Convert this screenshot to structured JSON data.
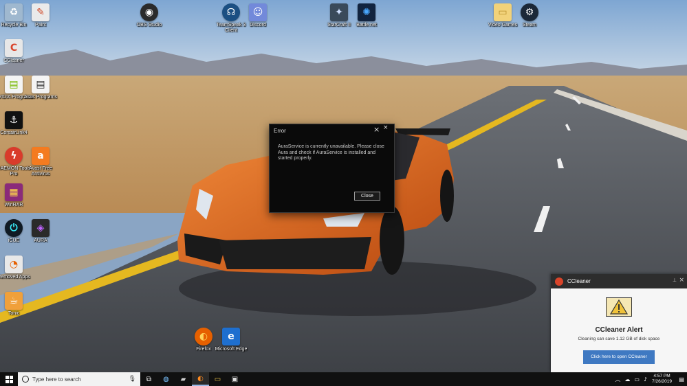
{
  "desktop": {
    "icons": [
      {
        "label": "Recycle Bin",
        "icon": "recycle-bin-icon",
        "color": "#9fb8cf"
      },
      {
        "label": "Paint",
        "icon": "paint-icon",
        "color": "#e8e8e8"
      },
      {
        "label": "OBS Studio",
        "icon": "obs-icon",
        "color": "#2b2b2b"
      },
      {
        "label": "TeamSpeak 3 Client",
        "icon": "teamspeak-icon",
        "color": "#1b4f82"
      },
      {
        "label": "Discord",
        "icon": "discord-icon",
        "color": "#7289da"
      },
      {
        "label": "StarCraft II",
        "icon": "starcraft-icon",
        "color": "#3a4a5a"
      },
      {
        "label": "Battle.net",
        "icon": "battlenet-icon",
        "color": "#12243f"
      },
      {
        "label": "Video Games",
        "icon": "folder-icon",
        "color": "#f2d27a"
      },
      {
        "label": "Steam",
        "icon": "steam-icon",
        "color": "#1b2838"
      },
      {
        "label": "CCleaner",
        "icon": "ccleaner-icon",
        "color": "#e7e7e7"
      },
      {
        "label": "NVIDIA Programs",
        "icon": "shortcut-icon",
        "color": "#f4f4f4"
      },
      {
        "label": "Asus Programs",
        "icon": "shortcut-icon",
        "color": "#f4f4f4"
      },
      {
        "label": "CorsairLink4",
        "icon": "corsair-icon",
        "color": "#111111"
      },
      {
        "label": "DAEMON Tools Pro",
        "icon": "daemon-tools-icon",
        "color": "#d93b2b"
      },
      {
        "label": "Avast Free Antivirus",
        "icon": "avast-icon",
        "color": "#f47b20"
      },
      {
        "label": "WinRAR",
        "icon": "winrar-icon",
        "color": "#8a2a7a"
      },
      {
        "label": "iCUE",
        "icon": "icue-icon",
        "color": "#101a24"
      },
      {
        "label": "AURA",
        "icon": "aura-icon",
        "color": "#2a2a2a"
      },
      {
        "label": "Removed Apps",
        "icon": "removed-apps-icon",
        "color": "#e8e8e8"
      },
      {
        "label": "Tonic",
        "icon": "tonic-icon",
        "color": "#f0a03a"
      },
      {
        "label": "Firefox",
        "icon": "firefox-icon",
        "color": "#e66000"
      },
      {
        "label": "Microsoft Edge",
        "icon": "edge-icon",
        "color": "#1e6fcf"
      }
    ]
  },
  "dialog": {
    "title": "Error",
    "message": "AuraService is currently unavailable. Please close Aura and check if AuraService is installed and started properly.",
    "close_button": "Close",
    "close_icon": "×"
  },
  "ccleaner_notification": {
    "app_name": "CCleaner",
    "alert_title": "CCleaner Alert",
    "alert_text": "Cleaning can save 1.12 GB of disk space",
    "button": "Click here to open CCleaner",
    "accent": "#3f79c2"
  },
  "taskbar": {
    "search_placeholder": "Type here to search",
    "clock_time": "4:57 PM",
    "clock_date": "7/26/2019"
  }
}
